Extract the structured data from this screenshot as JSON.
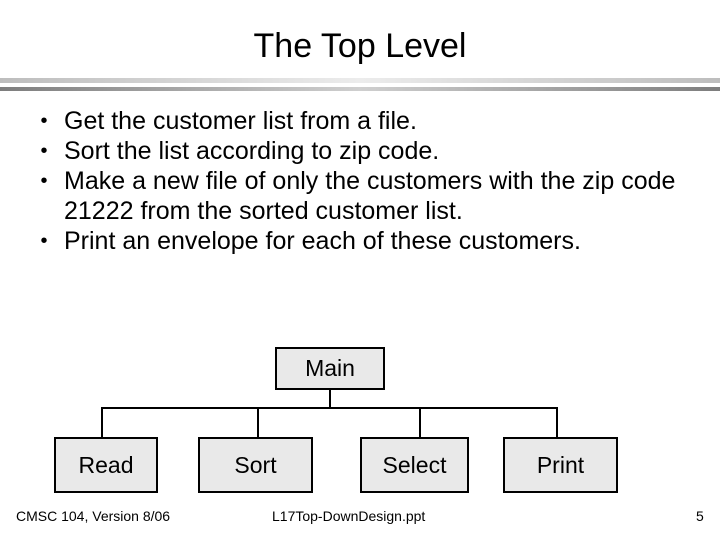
{
  "slide": {
    "title": "The Top Level",
    "bullets": [
      "Get the customer list from a file.",
      "Sort the list according to zip code.",
      "Make a new file of only the customers with the zip code 21222 from the sorted customer list.",
      "Print an envelope for each of these customers."
    ],
    "bullet_glyph": "•"
  },
  "diagram": {
    "root": "Main",
    "children": [
      "Read",
      "Sort",
      "Select",
      "Print"
    ],
    "box_fill": "#e9e9e9"
  },
  "footer": {
    "left": "CMSC 104, Version 8/06",
    "center": "L17Top-DownDesign.ppt",
    "page_number": "5"
  }
}
